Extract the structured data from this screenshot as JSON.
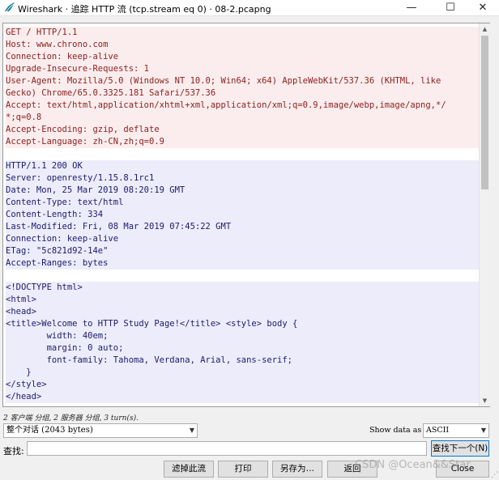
{
  "window": {
    "title": "Wireshark · 追踪 HTTP 流 (tcp.stream eq 0) · 08-2.pcapng",
    "icon": "wireshark-fin-icon",
    "controls": {
      "minimize": "—",
      "maximize": "☐",
      "close": "✕"
    }
  },
  "stream": {
    "client_request": [
      "GET / HTTP/1.1",
      "Host: www.chrono.com",
      "Connection: keep-alive",
      "Upgrade-Insecure-Requests: 1",
      "User-Agent: Mozilla/5.0 (Windows NT 10.0; Win64; x64) AppleWebKit/537.36 (KHTML, like",
      "Gecko) Chrome/65.0.3325.181 Safari/537.36",
      "Accept: text/html,application/xhtml+xml,application/xml;q=0.9,image/webp,image/apng,*/",
      "*;q=0.8",
      "Accept-Encoding: gzip, deflate",
      "Accept-Language: zh-CN,zh;q=0.9"
    ],
    "server_response": [
      "HTTP/1.1 200 OK",
      "Server: openresty/1.15.8.1rc1",
      "Date: Mon, 25 Mar 2019 08:20:19 GMT",
      "Content-Type: text/html",
      "Content-Length: 334",
      "Last-Modified: Fri, 08 Mar 2019 07:45:22 GMT",
      "Connection: keep-alive",
      "ETag: \"5c821d92-14e\"",
      "Accept-Ranges: bytes"
    ],
    "server_body": [
      "<!DOCTYPE html>",
      "<html>",
      "<head>",
      "<title>Welcome to HTTP Study Page!</title> <style> body {",
      "        width: 40em;",
      "        margin: 0 auto;",
      "        font-family: Tahoma, Verdana, Arial, sans-serif;",
      "    }",
      "</style>",
      "</head>"
    ]
  },
  "summary": "2 客户端 分组, 2 服务器 分组, 3 turn(s).",
  "conversation_select": {
    "value": "整个对话 (2043 bytes)"
  },
  "show_data": {
    "label": "Show data as",
    "value": "ASCII"
  },
  "find": {
    "label": "查找:",
    "value": "",
    "next_button": "查找下一个(N)"
  },
  "buttons": {
    "filter_out": "滤掉此流",
    "print": "打印",
    "save_as": "另存为…",
    "back": "返回",
    "close": "Close"
  },
  "watermark": "CSDN @Ocean&&Star",
  "colors": {
    "client_text": "#8c1e1e",
    "client_bg": "#fbeded",
    "server_text": "#1b1b6e",
    "server_bg": "#ececfa"
  }
}
